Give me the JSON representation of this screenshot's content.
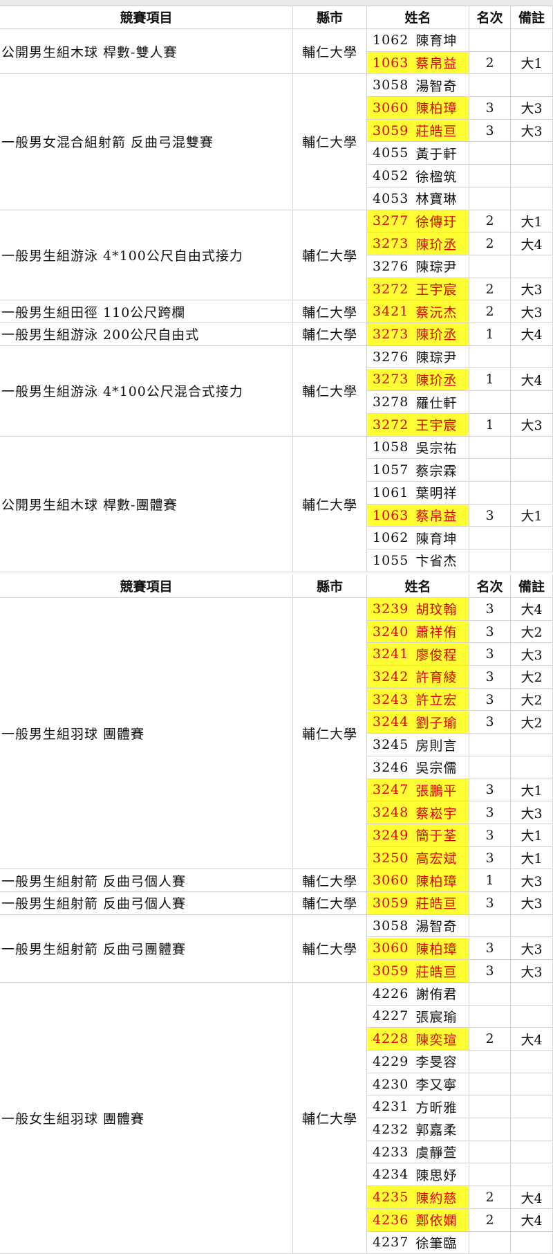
{
  "colors": {
    "highlight_bg": "#ffff33",
    "highlight_text": "#e00000",
    "grid": "#d4d4d4"
  },
  "headers": [
    "競賽項目",
    "縣市",
    "姓名",
    "名次",
    "備註"
  ],
  "sections": [
    {
      "groups": [
        {
          "event": "公開男生組木球 桿數-雙人賽",
          "city": "輔仁大學",
          "members": [
            {
              "id": "1062",
              "name": "陳育坤",
              "rank": "",
              "note": "",
              "hl": false
            },
            {
              "id": "1063",
              "name": "蔡帛益",
              "rank": "2",
              "note": "大1",
              "hl": true
            }
          ]
        },
        {
          "event": "一般男女混合組射箭 反曲弓混雙賽",
          "city": "輔仁大學",
          "members": [
            {
              "id": "3058",
              "name": "湯智奇",
              "rank": "",
              "note": "",
              "hl": false
            },
            {
              "id": "3060",
              "name": "陳柏璋",
              "rank": "3",
              "note": "大3",
              "hl": true
            },
            {
              "id": "3059",
              "name": "莊皓亘",
              "rank": "3",
              "note": "大3",
              "hl": true
            },
            {
              "id": "4055",
              "name": "黃于軒",
              "rank": "",
              "note": "",
              "hl": false
            },
            {
              "id": "4052",
              "name": "徐楹筑",
              "rank": "",
              "note": "",
              "hl": false
            },
            {
              "id": "4053",
              "name": "林寶琳",
              "rank": "",
              "note": "",
              "hl": false
            }
          ]
        },
        {
          "event": "一般男生組游泳 4*100公尺自由式接力",
          "city": "輔仁大學",
          "members": [
            {
              "id": "3277",
              "name": "徐傳玗",
              "rank": "2",
              "note": "大1",
              "hl": true
            },
            {
              "id": "3273",
              "name": "陳玠丞",
              "rank": "2",
              "note": "大4",
              "hl": true
            },
            {
              "id": "3276",
              "name": "陳琮尹",
              "rank": "",
              "note": "",
              "hl": false
            },
            {
              "id": "3272",
              "name": "王宇宸",
              "rank": "2",
              "note": "大3",
              "hl": true
            }
          ]
        },
        {
          "event": "一般男生組田徑 110公尺跨欄",
          "city": "輔仁大學",
          "members": [
            {
              "id": "3421",
              "name": "蔡沅杰",
              "rank": "2",
              "note": "大3",
              "hl": true
            }
          ]
        },
        {
          "event": "一般男生組游泳 200公尺自由式",
          "city": "輔仁大學",
          "members": [
            {
              "id": "3273",
              "name": "陳玠丞",
              "rank": "1",
              "note": "大4",
              "hl": true
            }
          ]
        },
        {
          "event": "一般男生組游泳 4*100公尺混合式接力",
          "city": "輔仁大學",
          "members": [
            {
              "id": "3276",
              "name": "陳琮尹",
              "rank": "",
              "note": "",
              "hl": false
            },
            {
              "id": "3273",
              "name": "陳玠丞",
              "rank": "1",
              "note": "大4",
              "hl": true
            },
            {
              "id": "3278",
              "name": "羅仕軒",
              "rank": "",
              "note": "",
              "hl": false
            },
            {
              "id": "3272",
              "name": "王宇宸",
              "rank": "1",
              "note": "大3",
              "hl": true
            }
          ]
        },
        {
          "event": "公開男生組木球 桿數-團體賽",
          "city": "輔仁大學",
          "members": [
            {
              "id": "1058",
              "name": "吳宗祐",
              "rank": "",
              "note": "",
              "hl": false
            },
            {
              "id": "1057",
              "name": "蔡宗霖",
              "rank": "",
              "note": "",
              "hl": false
            },
            {
              "id": "1061",
              "name": "葉明祥",
              "rank": "",
              "note": "",
              "hl": false
            },
            {
              "id": "1063",
              "name": "蔡帛益",
              "rank": "3",
              "note": "大1",
              "hl": true
            },
            {
              "id": "1062",
              "name": "陳育坤",
              "rank": "",
              "note": "",
              "hl": false
            },
            {
              "id": "1055",
              "name": "卞省杰",
              "rank": "",
              "note": "",
              "hl": false
            }
          ]
        }
      ]
    },
    {
      "groups": [
        {
          "event": "一般男生組羽球 團體賽",
          "city": "輔仁大學",
          "members": [
            {
              "id": "3239",
              "name": "胡玟翰",
              "rank": "3",
              "note": "大4",
              "hl": true
            },
            {
              "id": "3240",
              "name": "蕭祥侑",
              "rank": "3",
              "note": "大2",
              "hl": true
            },
            {
              "id": "3241",
              "name": "廖俊程",
              "rank": "3",
              "note": "大3",
              "hl": true
            },
            {
              "id": "3242",
              "name": "許育綾",
              "rank": "3",
              "note": "大2",
              "hl": true
            },
            {
              "id": "3243",
              "name": "許立宏",
              "rank": "3",
              "note": "大2",
              "hl": true
            },
            {
              "id": "3244",
              "name": "劉子瑜",
              "rank": "3",
              "note": "大2",
              "hl": true
            },
            {
              "id": "3245",
              "name": "房則言",
              "rank": "",
              "note": "",
              "hl": false
            },
            {
              "id": "3246",
              "name": "吳宗儒",
              "rank": "",
              "note": "",
              "hl": false
            },
            {
              "id": "3247",
              "name": "張鵬平",
              "rank": "3",
              "note": "大1",
              "hl": true
            },
            {
              "id": "3248",
              "name": "蔡崧宇",
              "rank": "3",
              "note": "大3",
              "hl": true
            },
            {
              "id": "3249",
              "name": "簡于荃",
              "rank": "3",
              "note": "大1",
              "hl": true
            },
            {
              "id": "3250",
              "name": "高宏斌",
              "rank": "3",
              "note": "大1",
              "hl": true
            }
          ]
        },
        {
          "event": "一般男生組射箭 反曲弓個人賽",
          "city": "輔仁大學",
          "members": [
            {
              "id": "3060",
              "name": "陳柏璋",
              "rank": "1",
              "note": "大3",
              "hl": true
            }
          ]
        },
        {
          "event": "一般男生組射箭 反曲弓個人賽",
          "city": "輔仁大學",
          "members": [
            {
              "id": "3059",
              "name": "莊皓亘",
              "rank": "3",
              "note": "大3",
              "hl": true
            }
          ]
        },
        {
          "event": "一般男生組射箭 反曲弓團體賽",
          "city": "輔仁大學",
          "members": [
            {
              "id": "3058",
              "name": "湯智奇",
              "rank": "",
              "note": "",
              "hl": false
            },
            {
              "id": "3060",
              "name": "陳柏璋",
              "rank": "3",
              "note": "大3",
              "hl": true
            },
            {
              "id": "3059",
              "name": "莊皓亘",
              "rank": "3",
              "note": "大3",
              "hl": true
            }
          ]
        },
        {
          "event": "一般女生組羽球 團體賽",
          "city": "輔仁大學",
          "members": [
            {
              "id": "4226",
              "name": "謝侑君",
              "rank": "",
              "note": "",
              "hl": false
            },
            {
              "id": "4227",
              "name": "張宸瑜",
              "rank": "",
              "note": "",
              "hl": false
            },
            {
              "id": "4228",
              "name": "陳奕瑄",
              "rank": "2",
              "note": "大4",
              "hl": true
            },
            {
              "id": "4229",
              "name": "李旻容",
              "rank": "",
              "note": "",
              "hl": false
            },
            {
              "id": "4230",
              "name": "李又寧",
              "rank": "",
              "note": "",
              "hl": false
            },
            {
              "id": "4231",
              "name": "方昕雅",
              "rank": "",
              "note": "",
              "hl": false
            },
            {
              "id": "4232",
              "name": "郭嘉柔",
              "rank": "",
              "note": "",
              "hl": false
            },
            {
              "id": "4233",
              "name": "虞靜萱",
              "rank": "",
              "note": "",
              "hl": false
            },
            {
              "id": "4234",
              "name": "陳思妤",
              "rank": "",
              "note": "",
              "hl": false
            },
            {
              "id": "4235",
              "name": "陳約慈",
              "rank": "2",
              "note": "大4",
              "hl": true
            },
            {
              "id": "4236",
              "name": "鄭依嫻",
              "rank": "2",
              "note": "大4",
              "hl": true
            },
            {
              "id": "4237",
              "name": "徐筆臨",
              "rank": "",
              "note": "",
              "hl": false
            }
          ]
        }
      ]
    }
  ]
}
